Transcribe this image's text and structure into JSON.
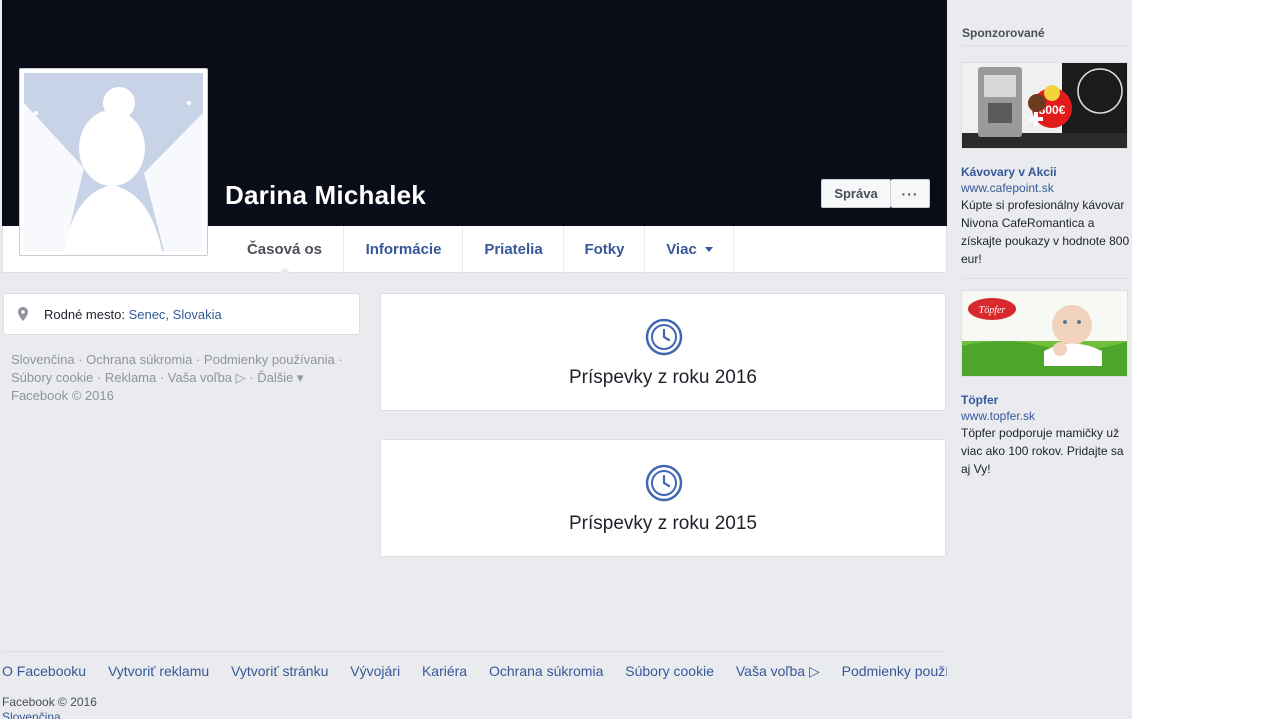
{
  "profile": {
    "name": "Darina Michalek",
    "manage_button": "Správa",
    "more_button": "···"
  },
  "tabs": [
    {
      "label": "Časová os",
      "active": true
    },
    {
      "label": "Informácie"
    },
    {
      "label": "Priatelia"
    },
    {
      "label": "Fotky"
    },
    {
      "label": "Viac"
    }
  ],
  "intro": {
    "hometown_label": "Rodné mesto:",
    "hometown_value": "Senec, Slovakia"
  },
  "mini_footer": {
    "line1": "Slovenčina · Ochrana súkromia · Podmienky používania ·",
    "line2": "Súbory cookie · Reklama · Vaša voľba ▷ · Ďalšie ▾",
    "line3": "Facebook © 2016"
  },
  "timeline": [
    {
      "label": "Príspevky z roku 2016"
    },
    {
      "label": "Príspevky z roku 2015"
    }
  ],
  "sponsored": {
    "title": "Sponzorované",
    "ads": [
      {
        "title": "Kávovary v Akcii",
        "url": "www.cafepoint.sk",
        "text": "Kúpte si profesionálny kávovar Nivona CafeRomantica a získajte poukazy v hodnote 800 eur!",
        "badge_value": "800€"
      },
      {
        "title": "Töpfer",
        "url": "www.topfer.sk",
        "text": "Töpfer podporuje mamičky už viac ako 100 rokov. Pridajte sa aj Vy!",
        "logo_text": "Töpfer"
      }
    ]
  },
  "footer": {
    "links": [
      "O Facebooku",
      "Vytvoriť reklamu",
      "Vytvoriť stránku",
      "Vývojári",
      "Kariéra",
      "Ochrana súkromia",
      "Súbory cookie",
      "Vaša voľba ▷",
      "Podmienky používania"
    ],
    "copyright": "Facebook © 2016",
    "language": "Slovenčina"
  },
  "colors": {
    "link": "#365899",
    "cover": "#0a0c18",
    "background": "#e9ebee"
  }
}
